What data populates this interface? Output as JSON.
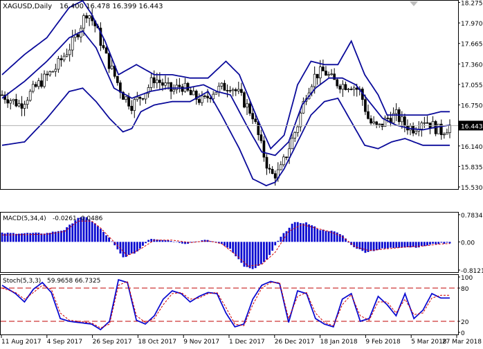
{
  "chart_data": [
    {
      "type": "candlestick",
      "panel": "price",
      "title": "XAGUSD,Daily",
      "ohlc_readout": "16.400 16.478 16.399 16.443",
      "last_price": "16.443",
      "ylim": [
        15.53,
        18.27
      ],
      "y_ticks": [
        "18.275",
        "17.970",
        "17.665",
        "17.360",
        "17.055",
        "16.750",
        "16.443",
        "16.140",
        "15.835",
        "15.530"
      ],
      "x_ticks": [
        "11 Aug 2017",
        "4 Sep 2017",
        "26 Sep 2017",
        "18 Oct 2017",
        "9 Nov 2017",
        "1 Dec 2017",
        "26 Dec 2017",
        "18 Jan 2018",
        "9 Feb 2018",
        "5 Mar 2018",
        "27 Mar 2018"
      ],
      "indicators": [
        "Bollinger Bands"
      ],
      "close_path": [
        [
          0,
          16.9
        ],
        [
          4,
          16.75
        ],
        [
          8,
          17.05
        ],
        [
          12,
          17.3
        ],
        [
          16,
          17.7
        ],
        [
          19,
          18.15
        ],
        [
          21,
          17.9
        ],
        [
          23,
          17.5
        ],
        [
          25,
          17.2
        ],
        [
          27,
          16.9
        ],
        [
          29,
          16.75
        ],
        [
          32,
          16.95
        ],
        [
          34,
          17.15
        ],
        [
          36,
          17.05
        ],
        [
          38,
          16.95
        ],
        [
          40,
          17.05
        ],
        [
          42,
          16.9
        ],
        [
          45,
          16.8
        ],
        [
          47,
          16.95
        ],
        [
          49,
          17.0
        ],
        [
          51,
          17.05
        ],
        [
          53,
          16.9
        ],
        [
          56,
          16.6
        ],
        [
          58,
          16.1
        ],
        [
          60,
          15.7
        ],
        [
          62,
          15.75
        ],
        [
          64,
          16.1
        ],
        [
          66,
          16.45
        ],
        [
          68,
          16.95
        ],
        [
          70,
          17.2
        ],
        [
          72,
          17.25
        ],
        [
          74,
          17.1
        ],
        [
          76,
          17.05
        ],
        [
          78,
          17.05
        ],
        [
          80,
          16.95
        ],
        [
          82,
          16.5
        ],
        [
          84,
          16.4
        ],
        [
          86,
          16.55
        ],
        [
          88,
          16.6
        ],
        [
          90,
          16.45
        ],
        [
          92,
          16.4
        ],
        [
          94,
          16.55
        ],
        [
          96,
          16.45
        ],
        [
          98,
          16.35
        ],
        [
          100,
          16.44
        ]
      ],
      "bollinger_upper": [
        [
          0,
          17.2
        ],
        [
          5,
          17.5
        ],
        [
          10,
          17.75
        ],
        [
          15,
          18.2
        ],
        [
          18,
          18.3
        ],
        [
          20,
          18.1
        ],
        [
          23,
          17.7
        ],
        [
          26,
          17.2
        ],
        [
          30,
          17.35
        ],
        [
          34,
          17.2
        ],
        [
          38,
          17.2
        ],
        [
          42,
          17.15
        ],
        [
          46,
          17.15
        ],
        [
          50,
          17.4
        ],
        [
          53,
          17.2
        ],
        [
          57,
          16.55
        ],
        [
          60,
          16.1
        ],
        [
          63,
          16.3
        ],
        [
          66,
          17.05
        ],
        [
          69,
          17.4
        ],
        [
          72,
          17.35
        ],
        [
          75,
          17.35
        ],
        [
          78,
          17.7
        ],
        [
          81,
          17.2
        ],
        [
          84,
          16.9
        ],
        [
          86,
          16.6
        ],
        [
          89,
          16.6
        ],
        [
          92,
          16.6
        ],
        [
          95,
          16.6
        ],
        [
          98,
          16.65
        ],
        [
          100,
          16.65
        ]
      ],
      "bollinger_middle": [
        [
          0,
          16.85
        ],
        [
          5,
          17.1
        ],
        [
          10,
          17.4
        ],
        [
          15,
          17.75
        ],
        [
          18,
          17.85
        ],
        [
          21,
          17.6
        ],
        [
          25,
          17.0
        ],
        [
          29,
          16.85
        ],
        [
          33,
          16.95
        ],
        [
          37,
          17.0
        ],
        [
          41,
          17.0
        ],
        [
          45,
          17.05
        ],
        [
          48,
          16.95
        ],
        [
          51,
          16.9
        ],
        [
          55,
          16.4
        ],
        [
          58,
          16.05
        ],
        [
          61,
          16.0
        ],
        [
          64,
          16.2
        ],
        [
          67,
          16.75
        ],
        [
          70,
          17.0
        ],
        [
          73,
          17.15
        ],
        [
          76,
          17.15
        ],
        [
          79,
          17.05
        ],
        [
          82,
          16.8
        ],
        [
          85,
          16.55
        ],
        [
          88,
          16.45
        ],
        [
          91,
          16.4
        ],
        [
          94,
          16.38
        ],
        [
          97,
          16.42
        ],
        [
          100,
          16.45
        ]
      ],
      "bollinger_lower": [
        [
          0,
          16.15
        ],
        [
          5,
          16.2
        ],
        [
          10,
          16.55
        ],
        [
          15,
          16.95
        ],
        [
          18,
          17.0
        ],
        [
          21,
          16.8
        ],
        [
          24,
          16.55
        ],
        [
          27,
          16.35
        ],
        [
          29,
          16.4
        ],
        [
          31,
          16.65
        ],
        [
          34,
          16.75
        ],
        [
          38,
          16.8
        ],
        [
          42,
          16.8
        ],
        [
          46,
          16.95
        ],
        [
          49,
          16.6
        ],
        [
          53,
          16.1
        ],
        [
          56,
          15.65
        ],
        [
          59,
          15.55
        ],
        [
          61,
          15.6
        ],
        [
          63,
          15.8
        ],
        [
          66,
          16.2
        ],
        [
          69,
          16.6
        ],
        [
          72,
          16.8
        ],
        [
          75,
          16.85
        ],
        [
          78,
          16.5
        ],
        [
          81,
          16.15
        ],
        [
          84,
          16.1
        ],
        [
          87,
          16.2
        ],
        [
          90,
          16.25
        ],
        [
          92,
          16.2
        ],
        [
          94,
          16.15
        ],
        [
          97,
          16.15
        ],
        [
          100,
          16.15
        ]
      ]
    },
    {
      "type": "bar",
      "panel": "macd",
      "title": "MACD(5,34,4)",
      "values_readout": "-0.0261 -0.0486",
      "y_ticks": [
        "0.7834",
        "0.00",
        "-0.8121"
      ],
      "ylim": [
        -0.8121,
        0.7834
      ],
      "histogram_path": [
        [
          0,
          0.25
        ],
        [
          10,
          0.25
        ],
        [
          14,
          0.35
        ],
        [
          17,
          0.7
        ],
        [
          19,
          0.7
        ],
        [
          21,
          0.5
        ],
        [
          24,
          0.1
        ],
        [
          27,
          -0.45
        ],
        [
          30,
          -0.3
        ],
        [
          33,
          0.1
        ],
        [
          37,
          0.05
        ],
        [
          41,
          -0.05
        ],
        [
          45,
          0.05
        ],
        [
          48,
          0.0
        ],
        [
          51,
          -0.2
        ],
        [
          54,
          -0.7
        ],
        [
          56,
          -0.8
        ],
        [
          59,
          -0.55
        ],
        [
          62,
          0.1
        ],
        [
          65,
          0.55
        ],
        [
          68,
          0.55
        ],
        [
          71,
          0.35
        ],
        [
          74,
          0.3
        ],
        [
          76,
          0.2
        ],
        [
          78,
          -0.1
        ],
        [
          81,
          -0.3
        ],
        [
          85,
          -0.2
        ],
        [
          89,
          -0.15
        ],
        [
          93,
          -0.15
        ],
        [
          97,
          -0.05
        ],
        [
          100,
          -0.03
        ]
      ],
      "signal_path": [
        [
          0,
          0.2
        ],
        [
          10,
          0.22
        ],
        [
          14,
          0.3
        ],
        [
          17,
          0.6
        ],
        [
          20,
          0.6
        ],
        [
          22,
          0.4
        ],
        [
          25,
          0.0
        ],
        [
          28,
          -0.4
        ],
        [
          31,
          -0.2
        ],
        [
          34,
          0.05
        ],
        [
          38,
          0.05
        ],
        [
          42,
          -0.02
        ],
        [
          46,
          0.03
        ],
        [
          49,
          -0.05
        ],
        [
          52,
          -0.35
        ],
        [
          55,
          -0.7
        ],
        [
          58,
          -0.65
        ],
        [
          61,
          -0.3
        ],
        [
          64,
          0.3
        ],
        [
          67,
          0.5
        ],
        [
          70,
          0.4
        ],
        [
          73,
          0.3
        ],
        [
          76,
          0.15
        ],
        [
          79,
          -0.15
        ],
        [
          82,
          -0.25
        ],
        [
          86,
          -0.2
        ],
        [
          90,
          -0.15
        ],
        [
          94,
          -0.12
        ],
        [
          98,
          -0.06
        ],
        [
          100,
          -0.05
        ]
      ]
    },
    {
      "type": "line",
      "panel": "stochastic",
      "title": "Stoch(5,3,3)",
      "values_readout": "59.9658 66.7325",
      "y_ticks": [
        "100",
        "80",
        "20",
        "0"
      ],
      "ylim": [
        0,
        100
      ],
      "levels": [
        80,
        20
      ],
      "main_path": [
        [
          0,
          85
        ],
        [
          3,
          70
        ],
        [
          5,
          55
        ],
        [
          7,
          78
        ],
        [
          9,
          90
        ],
        [
          11,
          72
        ],
        [
          13,
          25
        ],
        [
          15,
          20
        ],
        [
          17,
          18
        ],
        [
          20,
          15
        ],
        [
          22,
          5
        ],
        [
          24,
          20
        ],
        [
          26,
          95
        ],
        [
          28,
          90
        ],
        [
          30,
          22
        ],
        [
          32,
          15
        ],
        [
          34,
          30
        ],
        [
          36,
          60
        ],
        [
          38,
          75
        ],
        [
          40,
          70
        ],
        [
          42,
          55
        ],
        [
          44,
          65
        ],
        [
          46,
          72
        ],
        [
          48,
          70
        ],
        [
          50,
          35
        ],
        [
          52,
          10
        ],
        [
          54,
          15
        ],
        [
          56,
          60
        ],
        [
          58,
          85
        ],
        [
          60,
          92
        ],
        [
          62,
          88
        ],
        [
          64,
          18
        ],
        [
          66,
          75
        ],
        [
          68,
          70
        ],
        [
          70,
          25
        ],
        [
          72,
          15
        ],
        [
          74,
          10
        ],
        [
          76,
          60
        ],
        [
          78,
          70
        ],
        [
          80,
          20
        ],
        [
          82,
          25
        ],
        [
          84,
          65
        ],
        [
          86,
          50
        ],
        [
          88,
          30
        ],
        [
          90,
          70
        ],
        [
          92,
          25
        ],
        [
          94,
          40
        ],
        [
          96,
          70
        ],
        [
          98,
          62
        ]
      ],
      "signal_path": [
        [
          0,
          80
        ],
        [
          3,
          72
        ],
        [
          5,
          60
        ],
        [
          7,
          72
        ],
        [
          9,
          85
        ],
        [
          11,
          78
        ],
        [
          13,
          35
        ],
        [
          15,
          22
        ],
        [
          17,
          20
        ],
        [
          20,
          17
        ],
        [
          22,
          8
        ],
        [
          24,
          15
        ],
        [
          26,
          85
        ],
        [
          28,
          92
        ],
        [
          30,
          30
        ],
        [
          32,
          18
        ],
        [
          34,
          25
        ],
        [
          36,
          50
        ],
        [
          38,
          70
        ],
        [
          40,
          72
        ],
        [
          42,
          60
        ],
        [
          44,
          62
        ],
        [
          46,
          70
        ],
        [
          48,
          72
        ],
        [
          50,
          45
        ],
        [
          52,
          15
        ],
        [
          54,
          12
        ],
        [
          56,
          50
        ],
        [
          58,
          80
        ],
        [
          60,
          90
        ],
        [
          62,
          90
        ],
        [
          64,
          25
        ],
        [
          66,
          65
        ],
        [
          68,
          72
        ],
        [
          70,
          35
        ],
        [
          72,
          18
        ],
        [
          74,
          12
        ],
        [
          76,
          50
        ],
        [
          78,
          68
        ],
        [
          80,
          30
        ],
        [
          82,
          22
        ],
        [
          84,
          55
        ],
        [
          86,
          55
        ],
        [
          88,
          35
        ],
        [
          90,
          60
        ],
        [
          92,
          32
        ],
        [
          94,
          35
        ],
        [
          96,
          62
        ],
        [
          98,
          67
        ]
      ]
    }
  ]
}
